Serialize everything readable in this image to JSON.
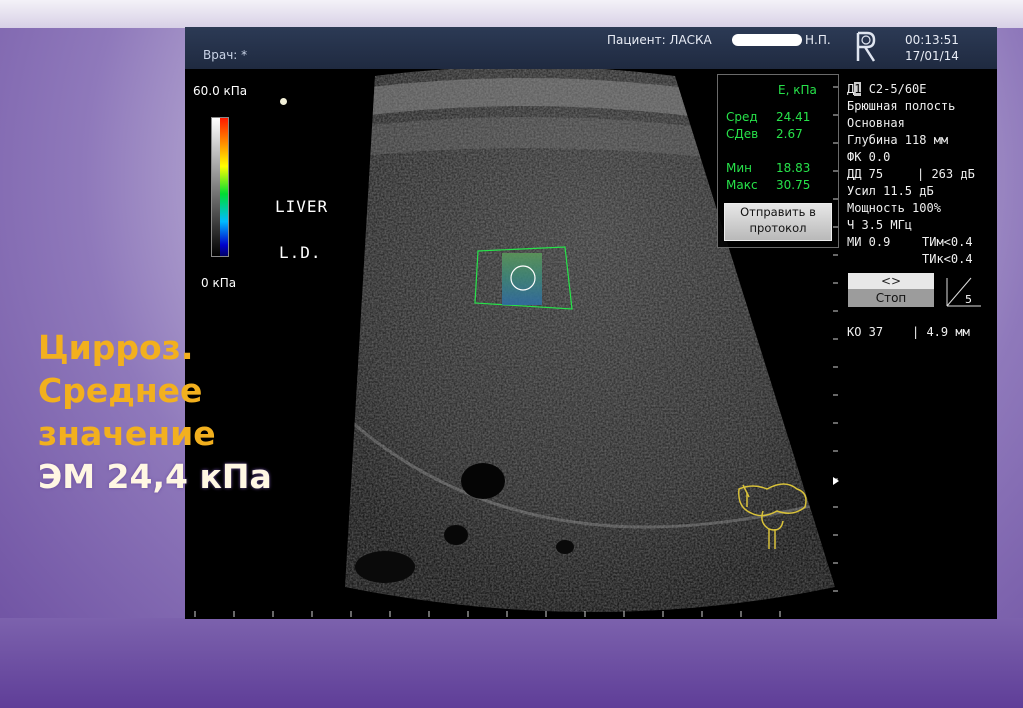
{
  "header": {
    "doctor_label": "Врач: *",
    "patient_label": "Пациент: ЛАСКА",
    "patient_suffix": "Н.П.",
    "time": "00:13:51",
    "date": "17/01/14",
    "logo_icon": "r-logo-icon"
  },
  "elastography_scale": {
    "max_label": "60.0 кПа",
    "min_label": "0 кПа"
  },
  "annotations": {
    "organ": "LIVER",
    "side": "L.D."
  },
  "stats": {
    "title": "E, кПа",
    "mean_label": "Сред",
    "mean_value": "24.41",
    "sd_label": "СДев",
    "sd_value": "2.67",
    "min_label": "Мин",
    "min_value": "18.83",
    "max_label": "Макс",
    "max_value": "30.75",
    "send_button_line1": "Отправить в",
    "send_button_line2": "протокол"
  },
  "params": {
    "probe_prefix": "Д",
    "probe_index": "1",
    "probe_model": "C2-5/60E",
    "preset": "Брюшная полость",
    "mode": "Основная",
    "depth": "Глубина 118 мм",
    "fc": "ФК 0.0",
    "dr_label": "ДД 75",
    "dr_db": "| 263  дБ",
    "gain": "Усил 11.5 дБ",
    "power": "Мощность 100%",
    "freq": "Ч 3.5 МГц",
    "mi": "МИ 0.9",
    "tis": "ТИм<0.4",
    "tib": "ТИк<0.4",
    "lr_button": "<>",
    "stop_button": "Стоп",
    "angle_value": "5",
    "ko": "КО 37",
    "ko_mm": "| 4.9 мм"
  },
  "caption": {
    "line1": "Цирроз.",
    "line2": "Среднее",
    "line3": "значение",
    "line4": "ЭМ 24,4 кПа"
  },
  "colors": {
    "roi_border": "#27e24a",
    "stats_text": "#27e24a",
    "caption_gold": "#f2b01e",
    "caption_white": "#fff7e3",
    "body_marker": "#d9c23a"
  }
}
